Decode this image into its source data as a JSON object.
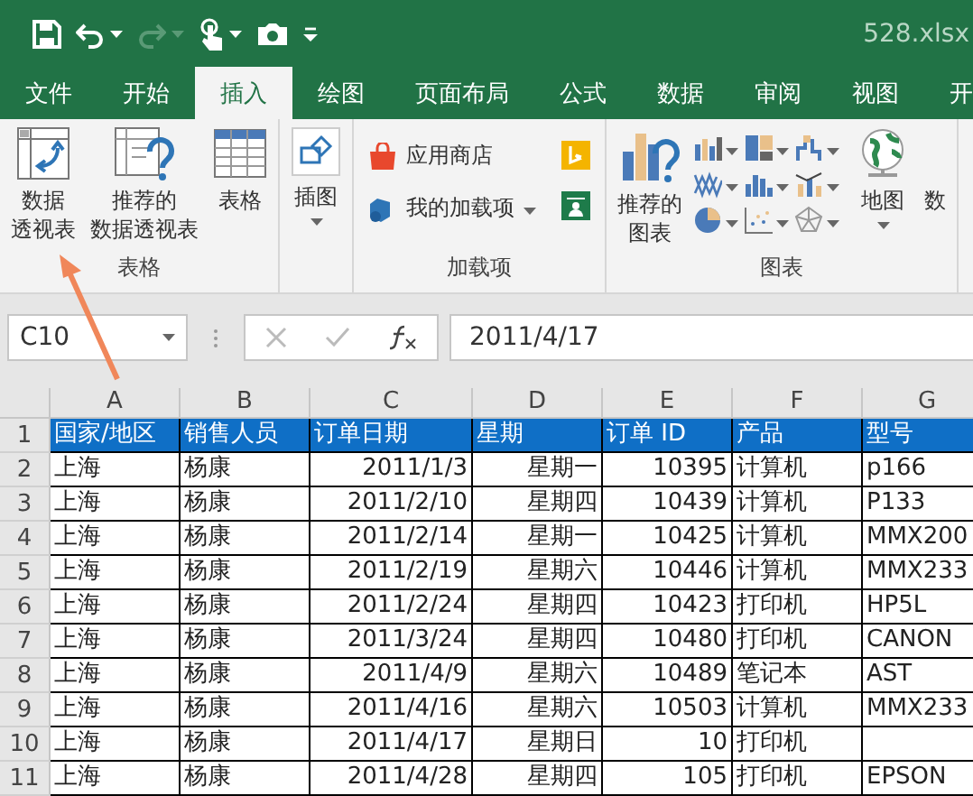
{
  "window": {
    "title": "528.xlsx"
  },
  "tabs": [
    {
      "label": "文件",
      "selected": false
    },
    {
      "label": "开始",
      "selected": false
    },
    {
      "label": "插入",
      "selected": true
    },
    {
      "label": "绘图",
      "selected": false
    },
    {
      "label": "页面布局",
      "selected": false
    },
    {
      "label": "公式",
      "selected": false
    },
    {
      "label": "数据",
      "selected": false
    },
    {
      "label": "审阅",
      "selected": false
    },
    {
      "label": "视图",
      "selected": false
    },
    {
      "label": "开",
      "selected": false
    }
  ],
  "ribbon": {
    "groups": [
      {
        "label": "表格",
        "items": [
          {
            "kind": "pivot",
            "lines": [
              "数据",
              "透视表"
            ]
          },
          {
            "kind": "recpivot",
            "lines": [
              "推荐的",
              "数据透视表"
            ]
          },
          {
            "kind": "table",
            "lines": [
              "表格"
            ]
          }
        ]
      },
      {
        "items": [
          {
            "kind": "illustration",
            "lines": [
              "插图"
            ],
            "dropdown": true
          }
        ]
      },
      {
        "label": "加载项",
        "items": [
          {
            "kind": "store",
            "lines": [
              "应用商店"
            ]
          },
          {
            "kind": "addins",
            "lines": [
              "我的加载项"
            ],
            "dropdown": true
          },
          {
            "kind": "bing"
          },
          {
            "kind": "people"
          }
        ]
      },
      {
        "label": "图表",
        "items": [
          {
            "kind": "recchart",
            "lines": [
              "推荐的",
              "图表"
            ]
          },
          {
            "kind": "charts"
          },
          {
            "kind": "map",
            "lines": [
              "地图"
            ],
            "dropdown": true
          },
          {
            "kind": "partial",
            "lines": [
              "数"
            ]
          }
        ]
      }
    ]
  },
  "formula_bar": {
    "name_box": "C10",
    "formula": "2011/4/17"
  },
  "sheet": {
    "columns": [
      "A",
      "B",
      "C",
      "D",
      "E",
      "F",
      "G"
    ],
    "rows": [
      {
        "number": "1",
        "kind": "header",
        "cells": [
          "国家/地区",
          "销售人员",
          "订单日期",
          "星期",
          "订单 ID",
          "产品",
          "型号"
        ]
      },
      {
        "number": "2",
        "kind": "data",
        "cells": [
          "上海",
          "杨康",
          "2011/1/3",
          "星期一",
          "10395",
          "计算机",
          "p166"
        ]
      },
      {
        "number": "3",
        "kind": "data",
        "cells": [
          "上海",
          "杨康",
          "2011/2/10",
          "星期四",
          "10439",
          "计算机",
          "P133"
        ]
      },
      {
        "number": "4",
        "kind": "data",
        "cells": [
          "上海",
          "杨康",
          "2011/2/14",
          "星期一",
          "10425",
          "计算机",
          "MMX200"
        ]
      },
      {
        "number": "5",
        "kind": "data",
        "cells": [
          "上海",
          "杨康",
          "2011/2/19",
          "星期六",
          "10446",
          "计算机",
          "MMX233"
        ]
      },
      {
        "number": "6",
        "kind": "data",
        "cells": [
          "上海",
          "杨康",
          "2011/2/24",
          "星期四",
          "10423",
          "打印机",
          "HP5L"
        ]
      },
      {
        "number": "7",
        "kind": "data",
        "cells": [
          "上海",
          "杨康",
          "2011/3/24",
          "星期四",
          "10480",
          "打印机",
          "CANON"
        ]
      },
      {
        "number": "8",
        "kind": "data",
        "cells": [
          "上海",
          "杨康",
          "2011/4/9",
          "星期六",
          "10489",
          "笔记本",
          "AST"
        ]
      },
      {
        "number": "9",
        "kind": "data",
        "cells": [
          "上海",
          "杨康",
          "2011/4/16",
          "星期六",
          "10503",
          "计算机",
          "MMX233"
        ]
      },
      {
        "number": "10",
        "kind": "data",
        "cells": [
          "上海",
          "杨康",
          "2011/4/17",
          "星期日",
          "10",
          "打印机"
        ]
      },
      {
        "number": "11",
        "kind": "data",
        "cells": [
          "上海",
          "杨康",
          "2011/4/28",
          "星期四",
          "105",
          "打印机",
          "EPSON"
        ]
      }
    ]
  }
}
